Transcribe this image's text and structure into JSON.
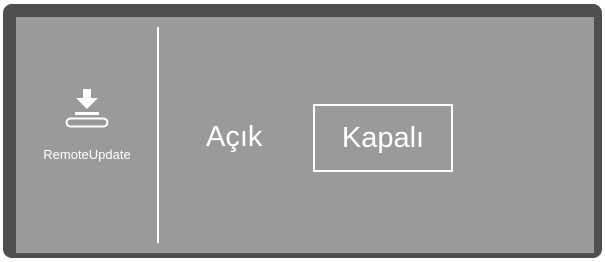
{
  "sidebar": {
    "icon": "download-to-tray-icon",
    "label": "RemoteUpdate"
  },
  "options": {
    "on_label": "Açık",
    "off_label": "Kapalı",
    "selected": "Kapalı"
  },
  "colors": {
    "frame": "#4f4f4f",
    "panel": "#9a9a9a",
    "foreground": "#ffffff"
  }
}
